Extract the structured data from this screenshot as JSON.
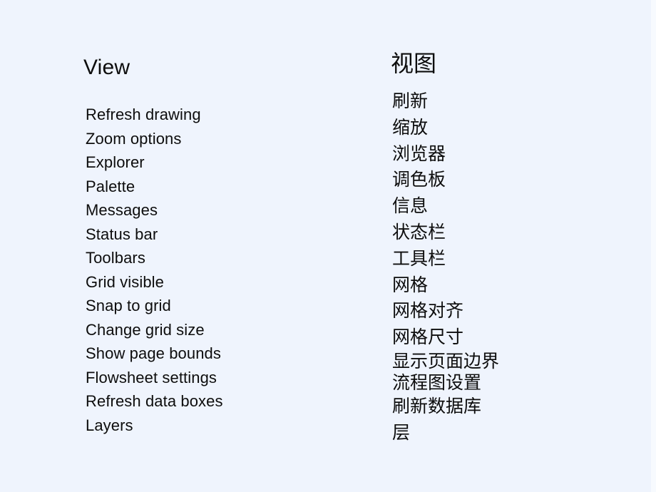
{
  "slide": {
    "background_color": "#eff4fd",
    "text_color": "#0d0d0d"
  },
  "columns": {
    "english": {
      "title": "View",
      "items": [
        "Refresh drawing",
        "Zoom options",
        "Explorer",
        "Palette",
        "Messages",
        "Status bar",
        "Toolbars",
        "Grid visible",
        "Snap to grid",
        "Change grid size",
        "Show page bounds",
        "Flowsheet settings",
        "Refresh data boxes",
        "Layers"
      ]
    },
    "chinese": {
      "title": "视图",
      "items": [
        "刷新",
        "缩放",
        "浏览器",
        "调色板",
        "信息",
        "状态栏",
        "工具栏",
        "网格",
        "网格对齐",
        "网格尺寸",
        "显示页面边界",
        "流程图设置",
        "刷新数据库",
        "层"
      ]
    }
  }
}
